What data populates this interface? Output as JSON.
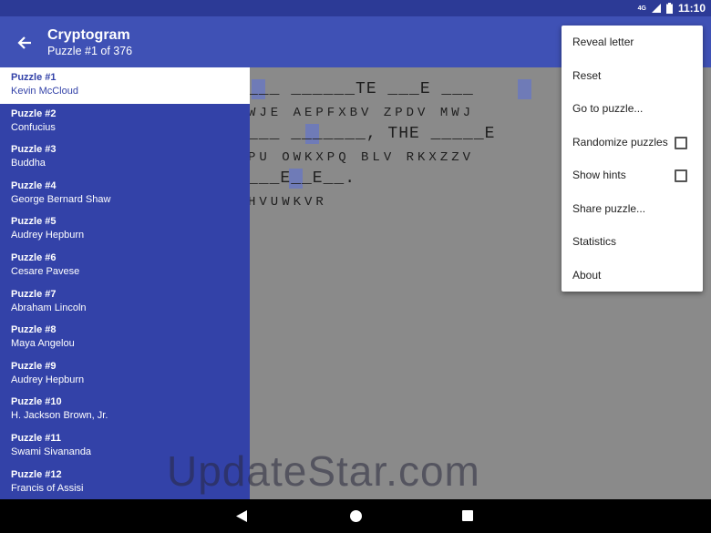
{
  "status": {
    "network": "4G",
    "time": "11:10"
  },
  "appbar": {
    "title": "Cryptogram",
    "subtitle": "Puzzle #1 of 376"
  },
  "puzzle": {
    "line1_guess": "___ ______TE ___E ___",
    "line1_cipher": "WJE AEPFXBV ZPDV MWJ",
    "line2_guess": "___ _______, THE _____E",
    "line2_cipher": "PU OWKXPQ BLV RKXZZV",
    "line3_guess": "___E__E__.",
    "line3_cipher": "HVUWKVR"
  },
  "drawer": {
    "items": [
      {
        "num": "Puzzle #1",
        "author": "Kevin McCloud"
      },
      {
        "num": "Puzzle #2",
        "author": "Confucius"
      },
      {
        "num": "Puzzle #3",
        "author": "Buddha"
      },
      {
        "num": "Puzzle #4",
        "author": "George Bernard Shaw"
      },
      {
        "num": "Puzzle #5",
        "author": "Audrey Hepburn"
      },
      {
        "num": "Puzzle #6",
        "author": "Cesare Pavese"
      },
      {
        "num": "Puzzle #7",
        "author": "Abraham Lincoln"
      },
      {
        "num": "Puzzle #8",
        "author": "Maya Angelou"
      },
      {
        "num": "Puzzle #9",
        "author": "Audrey Hepburn"
      },
      {
        "num": "Puzzle #10",
        "author": "H. Jackson Brown, Jr."
      },
      {
        "num": "Puzzle #11",
        "author": "Swami Sivananda"
      },
      {
        "num": "Puzzle #12",
        "author": "Francis of Assisi"
      }
    ]
  },
  "menu": {
    "reveal": "Reveal letter",
    "reset": "Reset",
    "goto": "Go to puzzle...",
    "randomize": "Randomize puzzles",
    "hints": "Show hints",
    "share": "Share puzzle...",
    "stats": "Statistics",
    "about": "About"
  },
  "watermark": "UpdateStar.com",
  "colors": {
    "primary": "#3f51b5",
    "statusbar": "#2c3a96",
    "drawer": "#3342a8"
  }
}
